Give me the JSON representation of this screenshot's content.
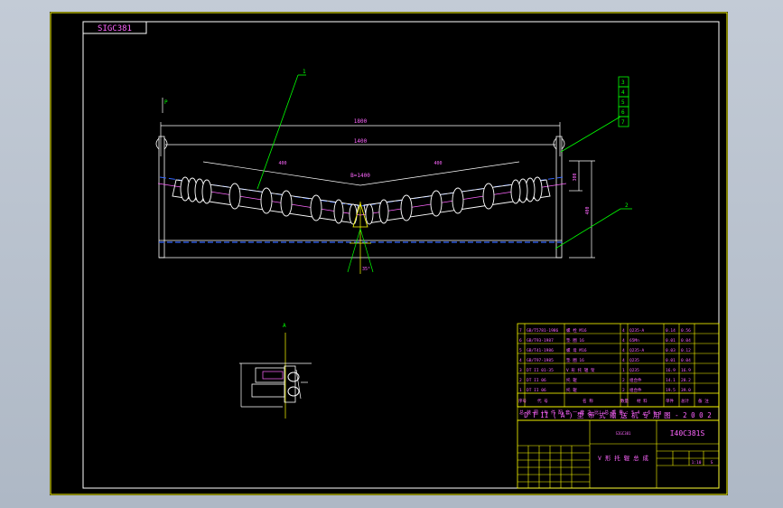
{
  "drawing": {
    "code_box": "SIGC381",
    "leaders": [
      "1",
      "2",
      "3",
      "4",
      "5",
      "6",
      "7"
    ],
    "dims": {
      "overall": "1800",
      "inner": "1400",
      "belt_width": "B=1400",
      "mid_left": "400",
      "mid_right": "400",
      "height": "400",
      "side_a": "300",
      "angle": "35°",
      "p": "P",
      "detail": "A"
    }
  },
  "parts_table": {
    "rows": [
      {
        "no": "7",
        "code": "GB/T5781-1986",
        "name": "螺 栓 M16",
        "qty": "4",
        "material": "Q235-A",
        "mass": "0.14",
        "total": "0.56"
      },
      {
        "no": "6",
        "code": "GB/T93-1987",
        "name": "垫 圈 16",
        "qty": "4",
        "material": "65Mn",
        "mass": "0.01",
        "total": "0.04"
      },
      {
        "no": "5",
        "code": "GB/T41-1986",
        "name": "螺 母 M16",
        "qty": "4",
        "material": "Q235-A",
        "mass": "0.03",
        "total": "0.12"
      },
      {
        "no": "4",
        "code": "GB/T97-1985",
        "name": "垫 圈 16",
        "qty": "4",
        "material": "Q235",
        "mass": "0.01",
        "total": "0.04"
      },
      {
        "no": "3",
        "code": "DT II 01-35",
        "name": "V 形 托 辊 架",
        "qty": "1",
        "material": "Q235",
        "mass": "16.9",
        "total": "16.9"
      },
      {
        "no": "2",
        "code": "DT II 06",
        "name": "托 辊",
        "qty": "2",
        "material": "组合件",
        "mass": "14.1",
        "total": "28.2"
      },
      {
        "no": "1",
        "code": "DT II 06",
        "name": "托 辊",
        "qty": "2",
        "material": "组合件",
        "mass": "19.5",
        "total": "39.0"
      }
    ],
    "header": [
      "序号",
      "代 号",
      "名 称",
      "数量",
      "材 料",
      "单件",
      "总计",
      "备 注"
    ],
    "remark_row": "总 装 图    (与 件 配 套  一 套 之 比)    总 质 量 : 5 4 . 6 k g",
    "series_title": "D T II ( A ) 型   带 式 输 送 机 专 用 图 - 2 0 0 2",
    "drawing_no_small": "SIGC381",
    "drawing_no": "I40C381S",
    "name": "V 形 托 辊 总 成",
    "scale": "1:10",
    "stage": "S"
  }
}
